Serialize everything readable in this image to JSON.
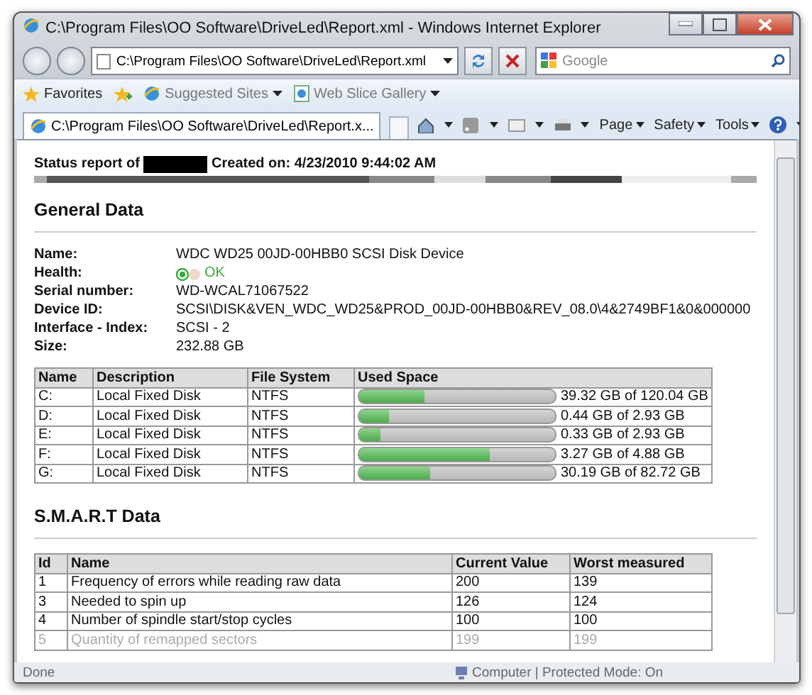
{
  "window": {
    "title": "C:\\Program Files\\OO Software\\DriveLed\\Report.xml - Windows Internet Explorer"
  },
  "address_bar": {
    "value": "C:\\Program Files\\OO Software\\DriveLed\\Report.xml"
  },
  "search": {
    "placeholder": "Google"
  },
  "favorites_bar": {
    "items": [
      {
        "label": "Favorites",
        "kind": "favorites"
      },
      {
        "label": "Suggested Sites",
        "kind": "dropdown"
      },
      {
        "label": "Web Slice Gallery",
        "kind": "dropdown"
      }
    ]
  },
  "tabs": [
    {
      "label": "C:\\Program Files\\OO Software\\DriveLed\\Report.x...",
      "selected": true
    }
  ],
  "command_bar": [
    "Page",
    "Safety",
    "Tools"
  ],
  "report": {
    "status_label": "Status report of",
    "created": "Created on: 4/23/2010 9:44:02 AM",
    "general_title": "General Data",
    "general": [
      {
        "label": "Name:",
        "value": "WDC WD25 00JD-00HBB0 SCSI Disk Device"
      },
      {
        "label": "Health:",
        "value": "OK",
        "kind": "health"
      },
      {
        "label": "Serial number:",
        "value": "WD-WCAL71067522"
      },
      {
        "label": "Device ID:",
        "value": "SCSI\\DISK&VEN_WDC_WD25&PROD_00JD-00HBB0&REV_08.0\\4&2749BF1&0&000000"
      },
      {
        "label": "Interface - Index:",
        "value": "SCSI - 2"
      },
      {
        "label": "Size:",
        "value": "232.88 GB"
      }
    ],
    "drives": {
      "columns": [
        "Name",
        "Description",
        "File System",
        "Used Space"
      ],
      "rows": [
        {
          "name": "C:",
          "description": "Local Fixed Disk",
          "file_system": "NTFS",
          "level": 0.33,
          "used": "39.32 GB of 120.04 GB"
        },
        {
          "name": "D:",
          "description": "Local Fixed Disk",
          "file_system": "NTFS",
          "level": 0.15,
          "used": "0.44 GB of 2.93 GB"
        },
        {
          "name": "E:",
          "description": "Local Fixed Disk",
          "file_system": "NTFS",
          "level": 0.11,
          "used": "0.33 GB of 2.93 GB"
        },
        {
          "name": "F:",
          "description": "Local Fixed Disk",
          "file_system": "NTFS",
          "level": 0.67,
          "used": "3.27 GB of 4.88 GB"
        },
        {
          "name": "G:",
          "description": "Local Fixed Disk",
          "file_system": "NTFS",
          "level": 0.365,
          "used": "30.19 GB of 82.72 GB"
        }
      ]
    },
    "smart_title": "S.M.A.R.T Data",
    "smart": {
      "columns": [
        "Id",
        "Name",
        "Current Value",
        "Worst measured"
      ],
      "rows": [
        [
          "1",
          "Frequency of errors while reading raw data",
          "200",
          "139"
        ],
        [
          "3",
          "Needed to spin up",
          "126",
          "124"
        ],
        [
          "4",
          "Number of spindle start/stop cycles",
          "100",
          "100"
        ],
        [
          "5",
          "Quantity of remapped sectors",
          "199",
          "199"
        ]
      ]
    }
  },
  "status_bar": {
    "text": "Done",
    "zone": "Computer | Protected Mode: On"
  }
}
